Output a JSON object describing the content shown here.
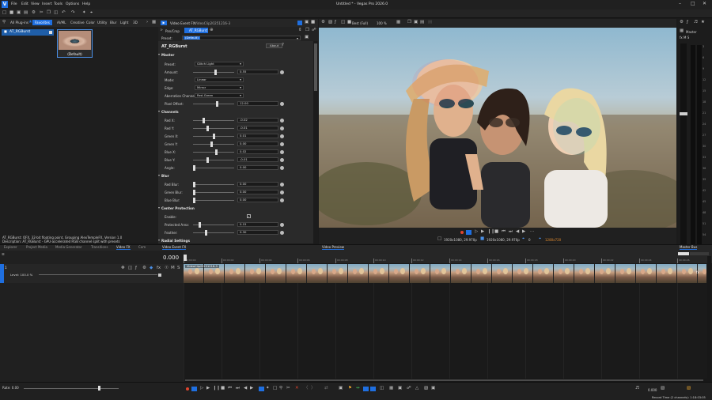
{
  "app": {
    "title": "Untitled * - Vegas Pro 2026.0",
    "logo": "V"
  },
  "menu": [
    "File",
    "Edit",
    "View",
    "Insert",
    "Tools",
    "Options",
    "Help"
  ],
  "plugin_tabs": [
    "All Plug-ins",
    "Favorites",
    "AI/ML",
    "Creative",
    "Color",
    "Utility",
    "Blur",
    "Light",
    "3D"
  ],
  "plugin_tree_item": "AT_RGBurst",
  "preset_thumb_caption": "(Default)",
  "description_lines": [
    "AT_RGBurst: OFX, 32-bit floating point, Grouping AlexTempleFX, Version 1.0",
    "Description: AT_RGBurst - GPU-accelerated RGB channel split with presets"
  ],
  "fx": {
    "window_title": "Video Event FX:",
    "clip_name": "VideoClip20251216-3",
    "crumb_first": "Pan/Crop",
    "crumb_second": "AT_RGBurst",
    "preset_label": "Preset:",
    "preset_value": "(Default)",
    "plugin_name": "AT_RGBurst",
    "about": "About",
    "sections": {
      "master": "Master",
      "channels": "Channels",
      "blur": "Blur",
      "center": "Center Protection",
      "radial": "Radial Settings"
    },
    "params": [
      {
        "label": "Preset:",
        "type": "dropdown",
        "value": "Glitch Light"
      },
      {
        "label": "Amount:",
        "type": "slider",
        "value": "0.55",
        "pos": 0.55
      },
      {
        "label": "Mode:",
        "type": "dropdown",
        "value": "Linear"
      },
      {
        "label": "Edge:",
        "type": "dropdown",
        "value": "Mirror"
      },
      {
        "label": "Aberration Channels:",
        "type": "dropdown",
        "value": "Red-Green"
      },
      {
        "label": "Pixel Offset:",
        "type": "slider",
        "value": "12.00",
        "pos": 0.6
      },
      {
        "label": "Red X:",
        "type": "slider",
        "value": "-0.02",
        "pos": 0.25
      },
      {
        "label": "Red Y:",
        "type": "slider",
        "value": "-0.01",
        "pos": 0.35
      },
      {
        "label": "Green X:",
        "type": "slider",
        "value": "0.01",
        "pos": 0.5
      },
      {
        "label": "Green Y:",
        "type": "slider",
        "value": "0.00",
        "pos": 0.45
      },
      {
        "label": "Blue X:",
        "type": "slider",
        "value": "0.02",
        "pos": 0.58
      },
      {
        "label": "Blue Y:",
        "type": "slider",
        "value": "-0.01",
        "pos": 0.35
      },
      {
        "label": "Angle:",
        "type": "slider",
        "value": "0.00",
        "pos": 0.0
      },
      {
        "label": "Red Blur:",
        "type": "slider",
        "value": "0.00",
        "pos": 0.0
      },
      {
        "label": "Green Blur:",
        "type": "slider",
        "value": "0.00",
        "pos": 0.0
      },
      {
        "label": "Blue Blur:",
        "type": "slider",
        "value": "0.00",
        "pos": 0.0
      },
      {
        "label": "Enable:",
        "type": "checkbox",
        "value": "✓"
      },
      {
        "label": "Protected Area:",
        "type": "slider",
        "value": "0.15",
        "pos": 0.15
      },
      {
        "label": "Feather:",
        "type": "slider",
        "value": "0.30",
        "pos": 0.3
      }
    ]
  },
  "preview": {
    "quality": "Best (Full)",
    "zoom": "100 %",
    "project_res": "1920x1080, 29.970p",
    "preview_res": "1920x1080, 29.970p",
    "frame": "0",
    "display": "1280x720"
  },
  "master": {
    "title": "Master",
    "scale": [
      "3",
      "6",
      "9",
      "12",
      "15",
      "18",
      "21",
      "24",
      "27",
      "30",
      "33",
      "36",
      "39",
      "42",
      "45",
      "48",
      "51",
      "54",
      "57"
    ]
  },
  "tabs": [
    "Explorer",
    "Project Media",
    "Media Generator",
    "Transitions",
    "Video FX",
    "Com",
    "Video Event FX",
    "Video Preview",
    "Master Bus"
  ],
  "timeline": {
    "time": "0.000",
    "level": "Level: 100.0 %",
    "clip_label": "VideoClip20251216-3",
    "ruler_marks": [
      "00:00:00",
      "00:00:02",
      "00:00:04",
      "00:00:06",
      "00:00:08",
      "00:00:10",
      "00:00:12",
      "00:00:14",
      "00:00:16",
      "00:00:18",
      "00:00:20",
      "00:00:22",
      "00:00:24",
      "00:00:26"
    ],
    "rate": "Rate: 0.00",
    "end_time": "0.000",
    "record_time": "Record Time (2 channels): 1:18:03:05"
  }
}
